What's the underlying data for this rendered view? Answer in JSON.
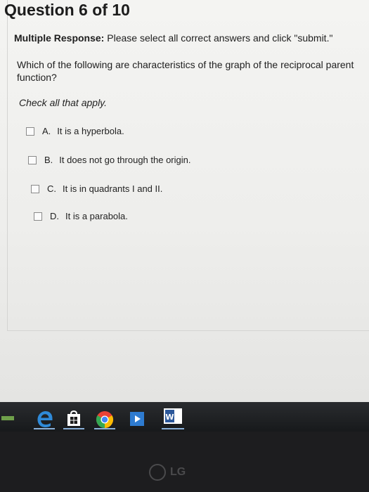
{
  "question": {
    "title": "Question 6 of 10",
    "instructions_bold": "Multiple Response:",
    "instructions_rest": "Please select all correct answers and click \"submit.\"",
    "prompt": "Which of the following are characteristics of the graph of the reciprocal parent function?",
    "check_all": "Check all that apply."
  },
  "options": [
    {
      "letter": "A.",
      "text": "It is a hyperbola.",
      "checked": false
    },
    {
      "letter": "B.",
      "text": "It does not go through the origin.",
      "checked": false
    },
    {
      "letter": "C.",
      "text": "It is in quadrants I and II.",
      "checked": false
    },
    {
      "letter": "D.",
      "text": "It is a parabola.",
      "checked": false
    }
  ],
  "taskbar": {
    "icons": [
      "edge-icon",
      "store-icon",
      "chrome-icon",
      "media-icon",
      "word-icon"
    ],
    "word_icon_label": "W"
  },
  "monitor": {
    "brand": "LG"
  }
}
